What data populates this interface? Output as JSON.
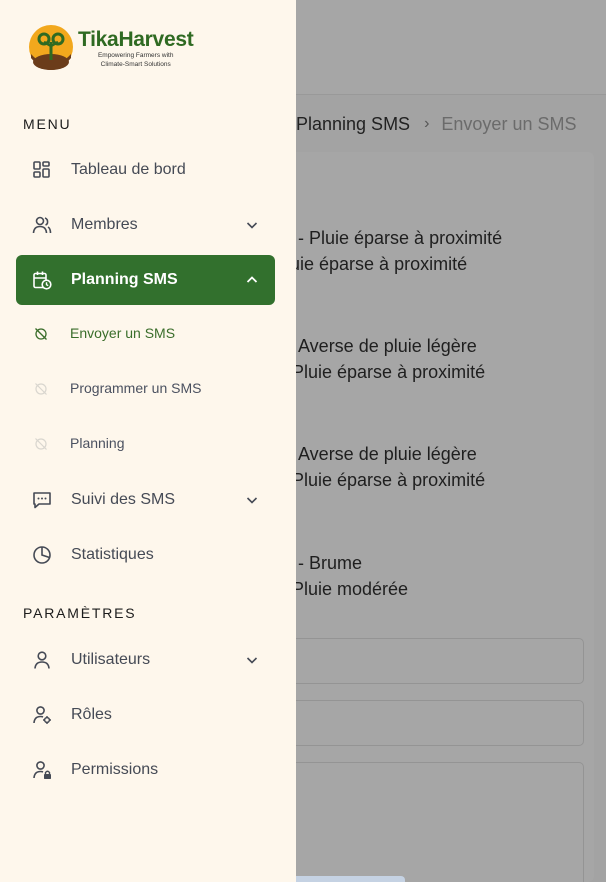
{
  "background": {
    "breadcrumb": {
      "parent": "Planning SMS",
      "separator": "›",
      "current": "Envoyer un SMS"
    },
    "lines": [
      "- Pluie éparse à proximité",
      "uie éparse à proximité",
      "Averse de pluie légère",
      "Pluie éparse à proximité",
      "Averse de pluie légère",
      "Pluie éparse à proximité",
      "- Brume",
      "Pluie modérée"
    ]
  },
  "sidebar": {
    "logo": {
      "title": "TikaHarvest",
      "tagline_line1": "Empowering Farmers with",
      "tagline_line2": "Climate-Smart Solutions"
    },
    "menu_title": "MENU",
    "settings_title": "PARAMÈTRES",
    "items": [
      {
        "label": "Tableau de bord",
        "icon": "dashboard-icon"
      },
      {
        "label": "Membres",
        "icon": "users-icon"
      },
      {
        "label": "Planning SMS",
        "icon": "calendar-clock-icon"
      },
      {
        "label": "Suivi des SMS",
        "icon": "message-icon"
      },
      {
        "label": "Statistiques",
        "icon": "pie-chart-icon"
      },
      {
        "label": "Utilisateurs",
        "icon": "user-icon"
      },
      {
        "label": "Rôles",
        "icon": "user-gear-icon"
      },
      {
        "label": "Permissions",
        "icon": "user-lock-icon"
      }
    ],
    "sub_items": [
      {
        "label": "Envoyer un SMS",
        "icon": "circle-off-icon"
      },
      {
        "label": "Programmer un SMS",
        "icon": "circle-off-icon"
      },
      {
        "label": "Planning",
        "icon": "circle-off-icon"
      }
    ]
  },
  "colors": {
    "primary": "#32702d",
    "sidebar_bg": "#fef7ec",
    "overlay_gray": "#a3a3a3"
  }
}
